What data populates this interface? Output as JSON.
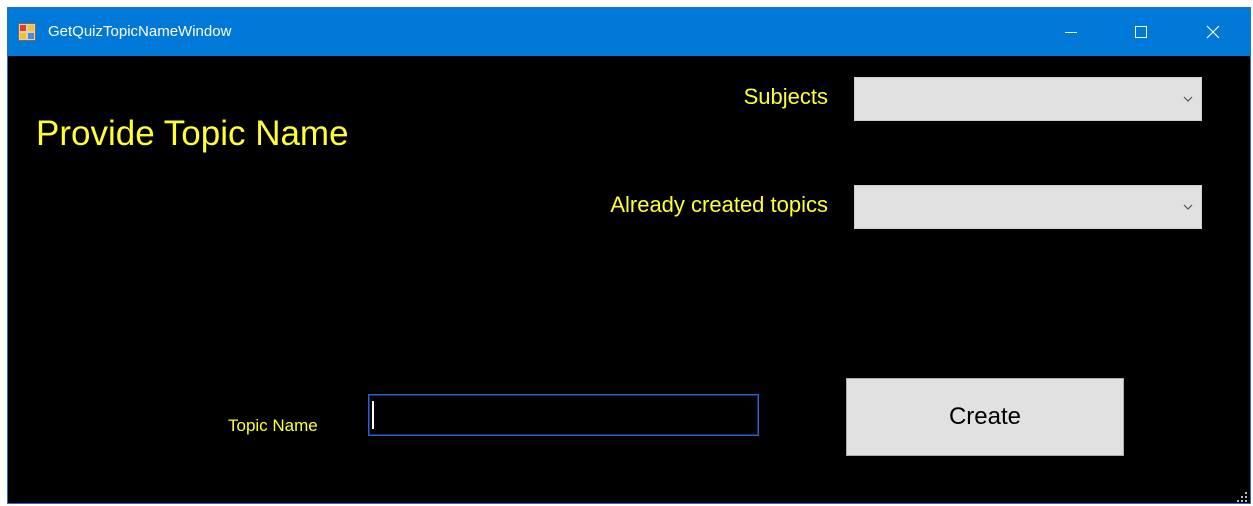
{
  "window": {
    "title": "GetQuizTopicNameWindow",
    "app_icon": "app-window-icon",
    "caption_buttons": [
      "minimize-icon",
      "maximize-icon",
      "close-icon"
    ]
  },
  "form": {
    "heading": "Provide Topic Name",
    "subjects": {
      "label": "Subjects",
      "selected_value": ""
    },
    "created_topics": {
      "label": "Already created topics",
      "selected_value": ""
    },
    "topic_name": {
      "label": "Topic Name",
      "value": "",
      "placeholder": ""
    },
    "create_button": {
      "label": "Create"
    }
  },
  "colors": {
    "titlebar": "#0078d7",
    "background": "#000000",
    "label_text": "#ffff33",
    "control_face": "#e1e1e1",
    "input_border": "#2a66c8"
  }
}
